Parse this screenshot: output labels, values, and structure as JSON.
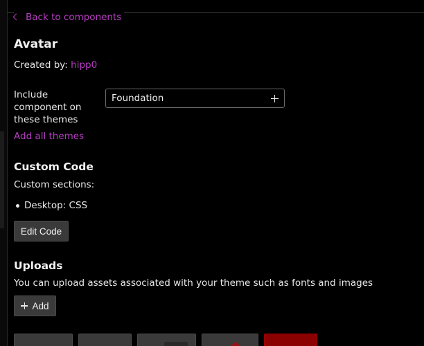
{
  "nav": {
    "back_label": "Back to components"
  },
  "component": {
    "title": "Avatar",
    "created_by_label": "Created by:",
    "author": "hipp0"
  },
  "themes": {
    "label": "Include component on these themes",
    "selected_theme": "Foundation",
    "add_all_label": "Add all themes"
  },
  "custom_code": {
    "heading": "Custom Code",
    "sections_label": "Custom sections:",
    "sections": [
      "Desktop: CSS"
    ],
    "edit_button_label": "Edit Code"
  },
  "uploads": {
    "heading": "Uploads",
    "description": "You can upload assets associated with your theme such as fonts and images",
    "add_button_label": "Add"
  },
  "colors": {
    "background": "#000000",
    "accent_link": "#b53cc0",
    "button_bg": "#3a3a3a",
    "danger": "#8b0000"
  },
  "icons": {
    "back": "chevron-left-icon",
    "theme_add": "plus-icon",
    "upload_add": "plus-icon"
  }
}
